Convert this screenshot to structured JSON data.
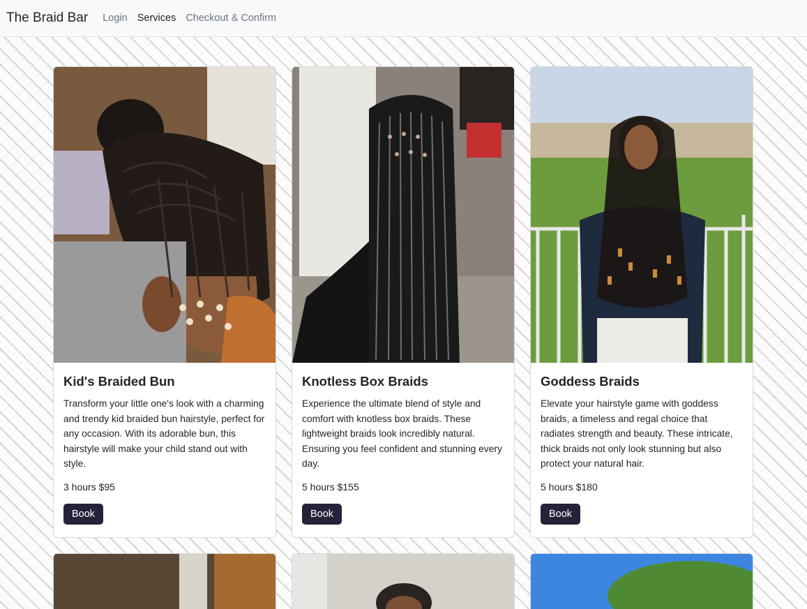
{
  "navbar": {
    "brand": "The Braid Bar",
    "links": [
      {
        "label": "Login"
      },
      {
        "label": "Services"
      },
      {
        "label": "Checkout & Confirm"
      }
    ]
  },
  "services": [
    {
      "title": "Kid's Braided Bun",
      "description": "Transform your little one's look with a charming and trendy kid braided bun hairstyle, perfect for any occasion. With its adorable bun, this hairstyle will make your child stand out with style.",
      "meta": "3 hours $95",
      "button": "Book"
    },
    {
      "title": "Knotless Box Braids",
      "description": "Experience the ultimate blend of style and comfort with knotless box braids. These lightweight braids look incredibly natural. Ensuring you feel confident and stunning every day.",
      "meta": "5 hours $155",
      "button": "Book"
    },
    {
      "title": "Goddess Braids",
      "description": "Elevate your hairstyle game with goddess braids, a timeless and regal choice that radiates strength and beauty. These intricate, thick braids not only look stunning but also protect your natural hair.",
      "meta": "5 hours $180",
      "button": "Book"
    }
  ],
  "colors": {
    "button_bg": "#27213a",
    "navbar_bg": "#f8f9fa"
  }
}
